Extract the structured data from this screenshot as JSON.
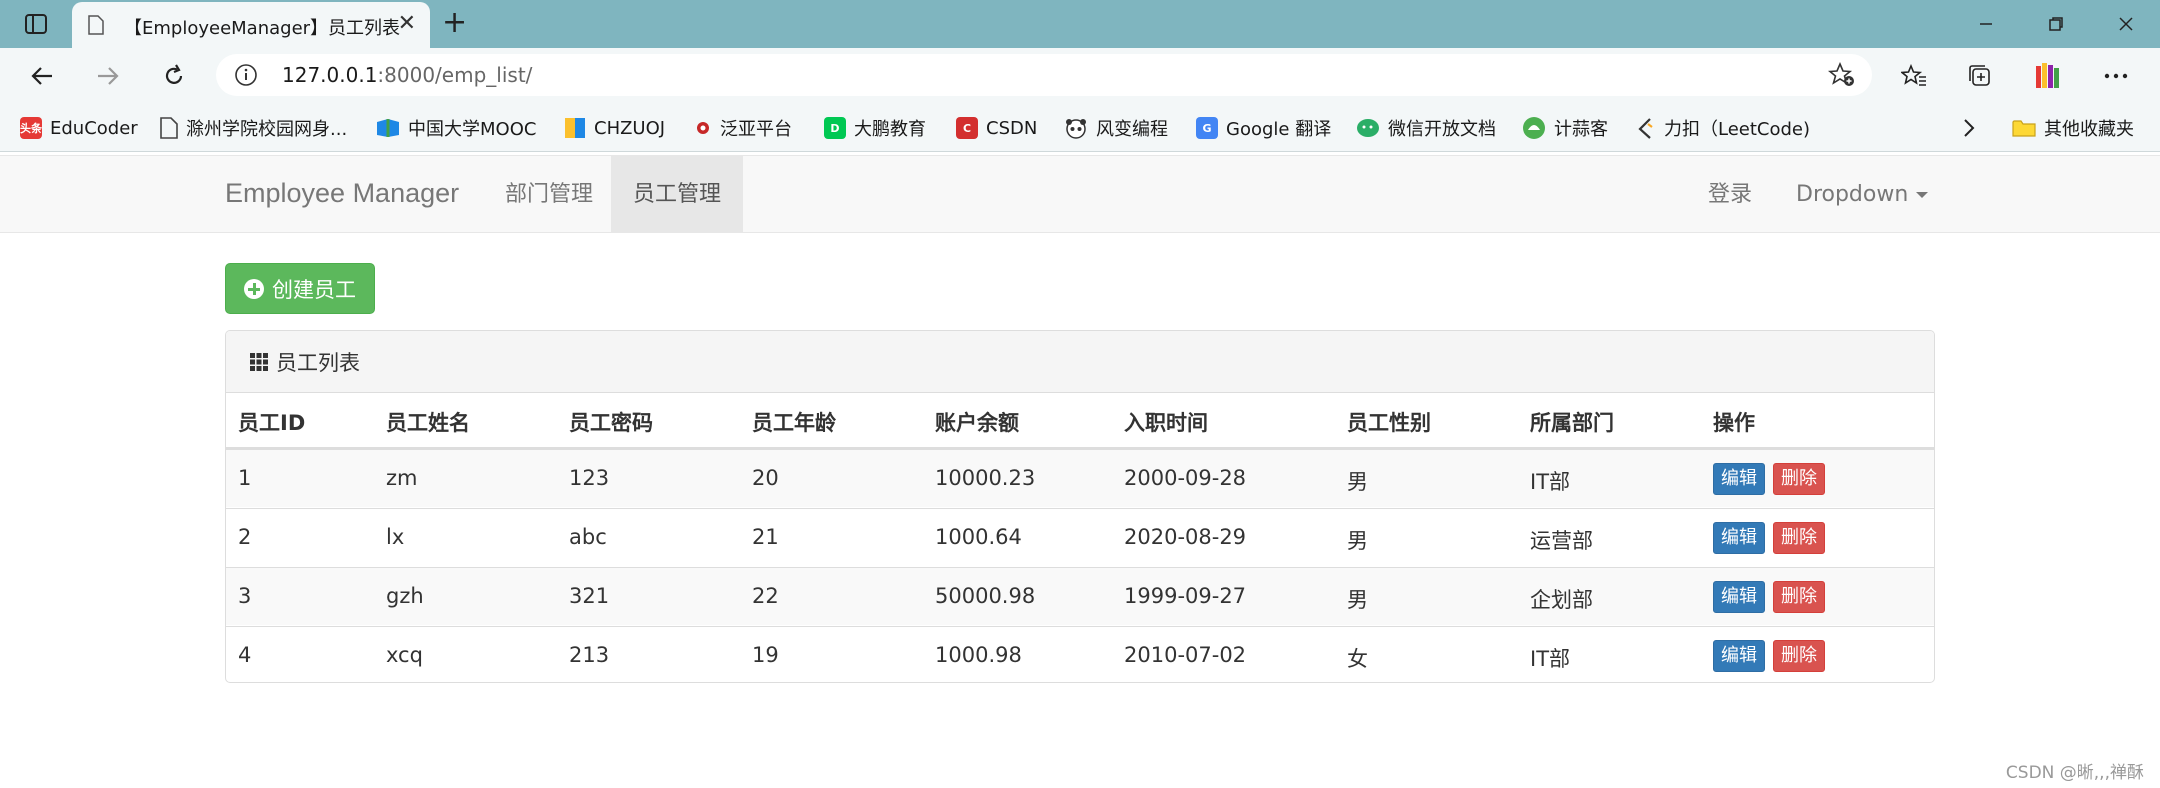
{
  "browser": {
    "tab_title": "【EmployeeManager】员工列表",
    "url_host": "127.0.0.1",
    "url_rest": ":8000/emp_list/",
    "bookmarks": [
      {
        "label": "EduCoder",
        "icon": "toutiao-icon",
        "color": "#e53935",
        "badge": "头条"
      },
      {
        "label": "滁州学院校园网身...",
        "icon": "page-icon",
        "color": "#ffffff",
        "badge": ""
      },
      {
        "label": "中国大学MOOC",
        "icon": "mooc-icon",
        "color": "#2e7d32",
        "badge": ""
      },
      {
        "label": "CHZUOJ",
        "icon": "chzuoj-icon",
        "color": "#f9a825",
        "badge": ""
      },
      {
        "label": "泛亚平台",
        "icon": "fanya-icon",
        "color": "#c62828",
        "badge": ""
      },
      {
        "label": "大鹏教育",
        "icon": "dapeng-icon",
        "color": "#00c853",
        "badge": "D"
      },
      {
        "label": "CSDN",
        "icon": "csdn-icon",
        "color": "#d32f2f",
        "badge": "C"
      },
      {
        "label": "风变编程",
        "icon": "panda-icon",
        "color": "#555555",
        "badge": ""
      },
      {
        "label": "Google 翻译",
        "icon": "google-translate-icon",
        "color": "#4285f4",
        "badge": "G"
      },
      {
        "label": "微信开放文档",
        "icon": "wechat-icon",
        "color": "#2aae67",
        "badge": ""
      },
      {
        "label": "计蒜客",
        "icon": "jisuanke-icon",
        "color": "#4caf50",
        "badge": ""
      },
      {
        "label": "力扣（LeetCode)",
        "icon": "leetcode-icon",
        "color": "#333333",
        "badge": ""
      }
    ],
    "other_bookmarks": "其他收藏夹"
  },
  "navbar": {
    "brand": "Employee Manager",
    "links": [
      "部门管理",
      "员工管理"
    ],
    "login": "登录",
    "dropdown": "Dropdown"
  },
  "create_button": "创建员工",
  "panel": {
    "title": "员工列表",
    "columns": [
      "员工ID",
      "员工姓名",
      "员工密码",
      "员工年龄",
      "账户余额",
      "入职时间",
      "员工性别",
      "所属部门",
      "操作"
    ],
    "rows": [
      [
        "1",
        "zm",
        "123",
        "20",
        "10000.23",
        "2000-09-28",
        "男",
        "IT部"
      ],
      [
        "2",
        "lx",
        "abc",
        "21",
        "1000.64",
        "2020-08-29",
        "男",
        "运营部"
      ],
      [
        "3",
        "gzh",
        "321",
        "22",
        "50000.98",
        "1999-09-27",
        "男",
        "企划部"
      ],
      [
        "4",
        "xcq",
        "213",
        "19",
        "1000.98",
        "2010-07-02",
        "女",
        "IT部"
      ]
    ],
    "edit_label": "编辑",
    "delete_label": "删除"
  },
  "watermark": "CSDN @晰,,,禅酥"
}
